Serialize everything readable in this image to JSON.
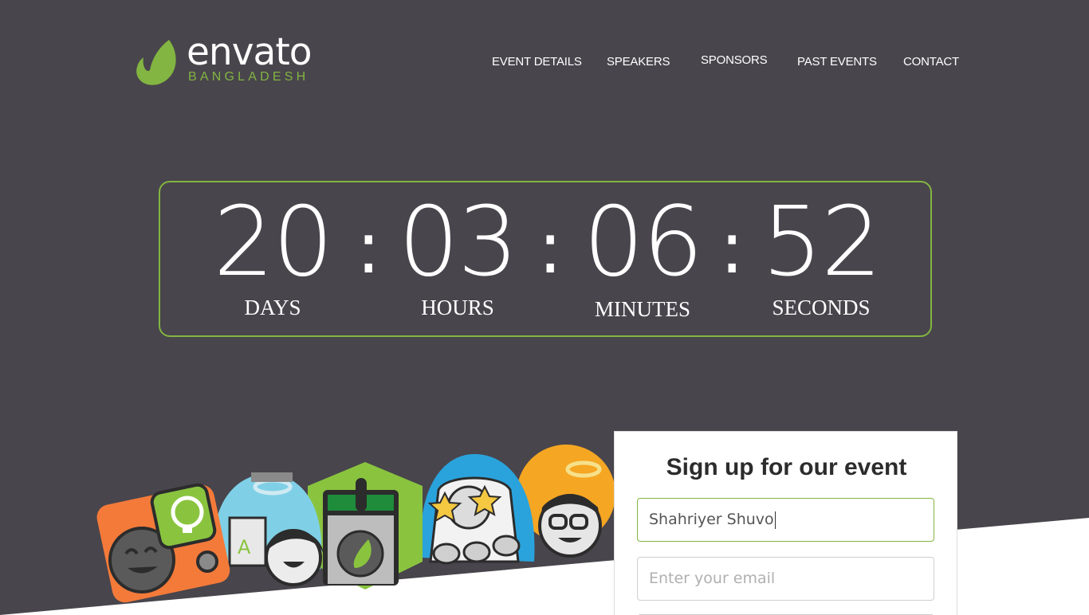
{
  "header": {
    "logo": {
      "brand": "envato",
      "sub": "BANGLADESH",
      "icon": "leaf-icon",
      "accent": "#82b541"
    },
    "nav": [
      "EVENT DETAILS",
      "SPEAKERS",
      "SPONSORS",
      "PAST EVENTS",
      "CONTACT"
    ]
  },
  "countdown": {
    "units": [
      {
        "value": "20",
        "label": "DAYS"
      },
      {
        "value": "03",
        "label": "HOURS"
      },
      {
        "value": "06",
        "label": "MINUTES"
      },
      {
        "value": "52",
        "label": "SECONDS"
      }
    ],
    "separator": ":"
  },
  "signup": {
    "title": "Sign up for our event",
    "name_value": "Shahriyer Shuvo",
    "email_placeholder": "Enter your email"
  },
  "colors": {
    "background": "#48454c",
    "accent": "#82b541",
    "text": "#ffffff"
  }
}
